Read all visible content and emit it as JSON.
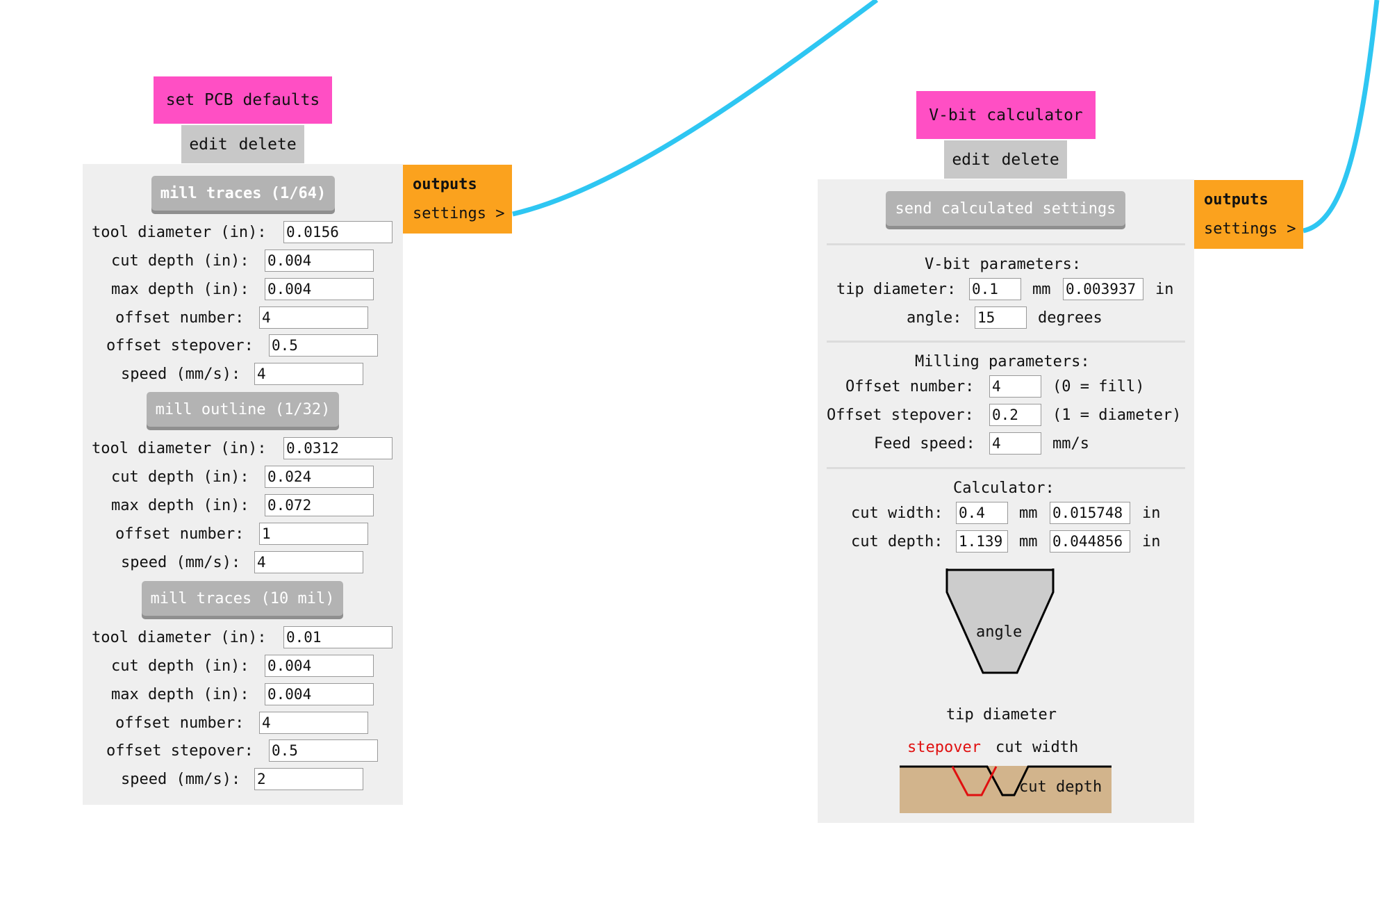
{
  "colors": {
    "wire": "#2ec6f2",
    "title_bg": "#ff4fc4",
    "outputs_bg": "#fba21e",
    "panel_bg": "#efefef",
    "button_bg": "#b3b3b3",
    "stepover_red": "#e01010",
    "material": "#d2b48c"
  },
  "pcb": {
    "title": "set PCB defaults",
    "edit": "edit",
    "delete": "delete",
    "outputs_label": "outputs",
    "settings_label": "settings >",
    "sections": [
      {
        "button": "mill traces (1/64)",
        "fields": [
          {
            "label": "tool diameter (in):",
            "value": "0.0156"
          },
          {
            "label": "cut depth (in):",
            "value": "0.004"
          },
          {
            "label": "max depth (in):",
            "value": "0.004"
          },
          {
            "label": "offset number:",
            "value": "4"
          },
          {
            "label": "offset stepover:",
            "value": "0.5"
          },
          {
            "label": "speed (mm/s):",
            "value": "4"
          }
        ]
      },
      {
        "button": "mill outline (1/32)",
        "fields": [
          {
            "label": "tool diameter (in):",
            "value": "0.0312"
          },
          {
            "label": "cut depth (in):",
            "value": "0.024"
          },
          {
            "label": "max depth (in):",
            "value": "0.072"
          },
          {
            "label": "offset number:",
            "value": "1"
          },
          {
            "label": "speed (mm/s):",
            "value": "4"
          }
        ]
      },
      {
        "button": "mill traces (10 mil)",
        "fields": [
          {
            "label": "tool diameter (in):",
            "value": "0.01"
          },
          {
            "label": "cut depth (in):",
            "value": "0.004"
          },
          {
            "label": "max depth (in):",
            "value": "0.004"
          },
          {
            "label": "offset number:",
            "value": "4"
          },
          {
            "label": "offset stepover:",
            "value": "0.5"
          },
          {
            "label": "speed (mm/s):",
            "value": "2"
          }
        ]
      }
    ]
  },
  "vbit": {
    "title": "V-bit calculator",
    "edit": "edit",
    "delete": "delete",
    "outputs_label": "outputs",
    "settings_label": "settings >",
    "send_button": "send calculated settings",
    "vbit_heading": "V-bit parameters:",
    "tip_label": "tip diameter:",
    "tip_mm": "0.1",
    "mm_unit": "mm",
    "tip_in": "0.003937",
    "in_unit": "in",
    "angle_label": "angle:",
    "angle_value": "15",
    "degrees_unit": "degrees",
    "milling_heading": "Milling parameters:",
    "offset_number_label": "Offset number:",
    "offset_number_value": "4",
    "offset_number_note": "(0 = fill)",
    "offset_stepover_label": "Offset stepover:",
    "offset_stepover_value": "0.2",
    "offset_stepover_note": "(1 = diameter)",
    "feed_label": "Feed speed:",
    "feed_value": "4",
    "feed_unit": "mm/s",
    "calc_heading": "Calculator:",
    "cut_width_label": "cut width:",
    "cut_width_mm": "0.4",
    "cut_width_in": "0.015748",
    "cut_depth_label": "cut depth:",
    "cut_depth_mm": "1.139",
    "cut_depth_in": "0.044856",
    "diagram": {
      "angle": "angle",
      "tip_diameter": "tip diameter",
      "stepover": "stepover",
      "cut_width": "cut width",
      "cut_depth": "cut depth"
    }
  }
}
